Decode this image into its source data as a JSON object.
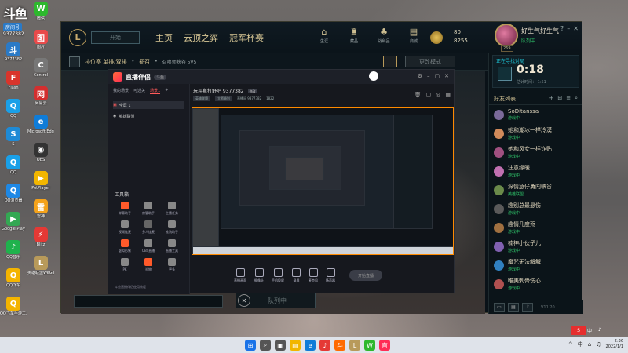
{
  "watermark": {
    "logo": "斗鱼",
    "room_label": "房间号",
    "room_number": "9377382"
  },
  "desktop": {
    "col1": [
      {
        "label": "9377382",
        "color": "#2a7ac7",
        "glyph": "斗"
      },
      {
        "label": "Flash",
        "color": "#d9342b",
        "glyph": "F"
      },
      {
        "label": "QQ",
        "color": "#1aa0e8",
        "glyph": "Q"
      },
      {
        "label": "S",
        "color": "#1e8ad6",
        "glyph": "S"
      },
      {
        "label": "QQ",
        "color": "#1aa0e8",
        "glyph": "Q"
      },
      {
        "label": "QQ浏览器",
        "color": "#1e88e5",
        "glyph": "Q"
      },
      {
        "label": "Google Play",
        "color": "#34a853",
        "glyph": "▶"
      },
      {
        "label": "QQ音乐",
        "color": "#1fb24c",
        "glyph": "♪"
      },
      {
        "label": "QQ飞车",
        "color": "#f4b400",
        "glyph": "Q"
      },
      {
        "label": "QQ飞车手游工具",
        "color": "#f4b400",
        "glyph": "Q"
      }
    ],
    "col2": [
      {
        "label": "微信",
        "color": "#2db82d",
        "glyph": "W"
      },
      {
        "label": "图片",
        "color": "#e94a4a",
        "glyph": "图"
      },
      {
        "label": "Control",
        "color": "#777",
        "glyph": "C"
      },
      {
        "label": "网易云",
        "color": "#d32f2f",
        "glyph": "网"
      },
      {
        "label": "Microsoft Edge",
        "color": "#0f7cd8",
        "glyph": "e"
      },
      {
        "label": "OBS",
        "color": "#333",
        "glyph": "◉"
      },
      {
        "label": "PotPlayer",
        "color": "#f2b600",
        "glyph": "▶"
      },
      {
        "label": "雷神",
        "color": "#f4a21a",
        "glyph": "雷"
      },
      {
        "label": "Blitz",
        "color": "#e53935",
        "glyph": "⚡"
      },
      {
        "label": "英雄联盟WeGame版",
        "color": "#b89a5a",
        "glyph": "L"
      }
    ]
  },
  "client": {
    "logo": "L",
    "play_button": "开始",
    "nav": [
      "主页",
      "云顶之弈",
      "冠军杯赛"
    ],
    "right_nav": [
      {
        "icon": "⌂",
        "label": "生涯"
      },
      {
        "icon": "♜",
        "label": "藏品"
      },
      {
        "icon": "♣",
        "label": "战利品"
      },
      {
        "icon": "▤",
        "label": "商城"
      }
    ],
    "currency": {
      "rp": "80",
      "be": "8255"
    },
    "profile": {
      "name": "好生气好生气",
      "status": "队列中",
      "level": "269"
    },
    "window_controls": [
      "?",
      "–",
      "✕"
    ],
    "queue": {
      "title": "排位赛 单排/双排",
      "separator": "•",
      "mode": "征召",
      "map": "召唤师峡谷 5V5"
    },
    "mode_button": "更改模式",
    "queue_button": "队列中"
  },
  "social": {
    "queue_label": "正在寻找对局",
    "timer": "0:18",
    "estimate": "估计时间： 1:51",
    "header": "好友列表",
    "header_icons": [
      "+",
      "⊞",
      "≡",
      "⌕"
    ],
    "friends": [
      {
        "name": "SoDitanssa",
        "status": "游戏中",
        "color": "#7a6a9a"
      },
      {
        "name": "她和潮冰一样冷漠",
        "status": "游戏中",
        "color": "#d08a5a"
      },
      {
        "name": "她和风女一样诈贴",
        "status": "游戏中",
        "color": "#a05080"
      },
      {
        "name": "注意缘暖",
        "status": "游戏中",
        "color": "#c070b0"
      },
      {
        "name": "深情急仔勇闯峡谷",
        "status": "英雄联盟",
        "color": "#6a8a4a"
      },
      {
        "name": "趣别总最悬伤",
        "status": "游戏中",
        "color": "#5a5a5a"
      },
      {
        "name": "趣情几度殇",
        "status": "游戏中",
        "color": "#a07040"
      },
      {
        "name": "楠神小伙子儿",
        "status": "游戏中",
        "color": "#8060b0"
      },
      {
        "name": "魔咒无法解解",
        "status": "游戏中",
        "color": "#3080c0"
      },
      {
        "name": "唯美刺骨伤心",
        "status": "游戏中",
        "color": "#b05050"
      }
    ],
    "footer_version": "V11.20"
  },
  "streamer": {
    "name": "直播伴侣",
    "version": "斗鱼",
    "room_title": "玩斗鱼打野吧 9377382",
    "room_tag": "修改",
    "room_meta": [
      "英雄联盟",
      "大师级别",
      "直播间 9377382",
      "1822"
    ],
    "tabs": [
      "我的场景",
      "可选关",
      "场景1",
      "+"
    ],
    "scenes": [
      "全屏 1",
      "英雄联盟"
    ],
    "tools_title": "工具箱",
    "tools": [
      {
        "label": "弹幕助手",
        "color": "#ff5a2a"
      },
      {
        "label": "房管助手",
        "color": "#888"
      },
      {
        "label": "主播任务",
        "color": "#888"
      },
      {
        "label": "视频连麦",
        "color": "#888"
      },
      {
        "label": "多人连麦",
        "color": "#666"
      },
      {
        "label": "推流助手",
        "color": "#888"
      },
      {
        "label": "虚拟形象",
        "color": "#ff5a2a"
      },
      {
        "label": "OBS直播",
        "color": "#888"
      },
      {
        "label": "直播工具",
        "color": "#888"
      },
      {
        "label": "PK",
        "color": "#888"
      },
      {
        "label": "礼物",
        "color": "#ff5a2a"
      },
      {
        "label": "更多",
        "color": "#888"
      }
    ],
    "tip": "斗鱼直播伴侣使用教程",
    "bottom_tools": [
      "直播画面",
      "摄像头",
      "手机投屏",
      "录屏",
      "麦克风",
      "扬声器"
    ],
    "live_button": "开始直播"
  },
  "taskbar": {
    "apps": [
      {
        "glyph": "⊞",
        "color": "#1a73e8"
      },
      {
        "glyph": "⌕",
        "color": "#555"
      },
      {
        "glyph": "▣",
        "color": "#555"
      },
      {
        "glyph": "▤",
        "color": "#f2b600"
      },
      {
        "glyph": "e",
        "color": "#0f7cd8"
      },
      {
        "glyph": "♪",
        "color": "#e53935"
      },
      {
        "glyph": "斗",
        "color": "#ff6a00"
      },
      {
        "glyph": "L",
        "color": "#b89a5a"
      },
      {
        "glyph": "W",
        "color": "#2db82d"
      },
      {
        "glyph": "直",
        "color": "#ff2d55"
      }
    ],
    "time": "2:36",
    "date": "2022/1/1",
    "tray_icons": [
      "^",
      "中",
      "⌂",
      "♫"
    ]
  }
}
